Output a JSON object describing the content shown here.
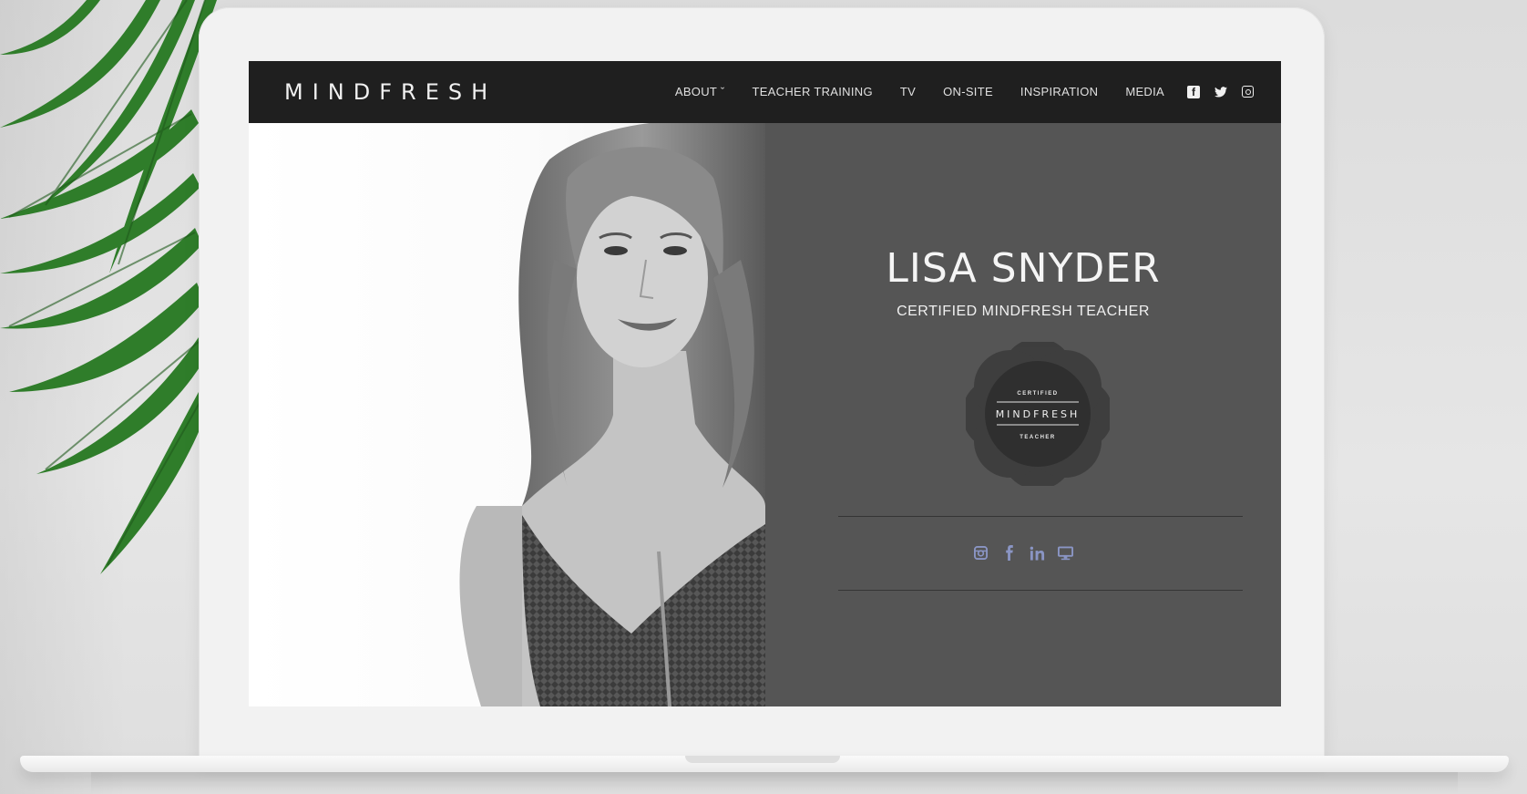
{
  "site": {
    "logo": "MINDFRESH",
    "nav": [
      "ABOUT ˇ",
      "TEACHER TRAINING",
      "TV",
      "ON-SITE",
      "INSPIRATION",
      "MEDIA"
    ],
    "header_social_icons": [
      "facebook-icon",
      "twitter-icon",
      "instagram-icon"
    ]
  },
  "profile": {
    "name": "LISA SNYDER",
    "title": "CERTIFIED MINDFRESH TEACHER",
    "badge": {
      "top": "CERTIFIED",
      "middle": "MINDFRESH",
      "bottom": "TEACHER"
    },
    "social_icons": [
      "instagram-icon",
      "facebook-icon",
      "linkedin-icon",
      "website-icon"
    ],
    "social_icon_color": "#8a95c4"
  },
  "colors": {
    "navbar": "#1f1f1f",
    "panel": "#555555",
    "badge": "#3a3a3a"
  }
}
